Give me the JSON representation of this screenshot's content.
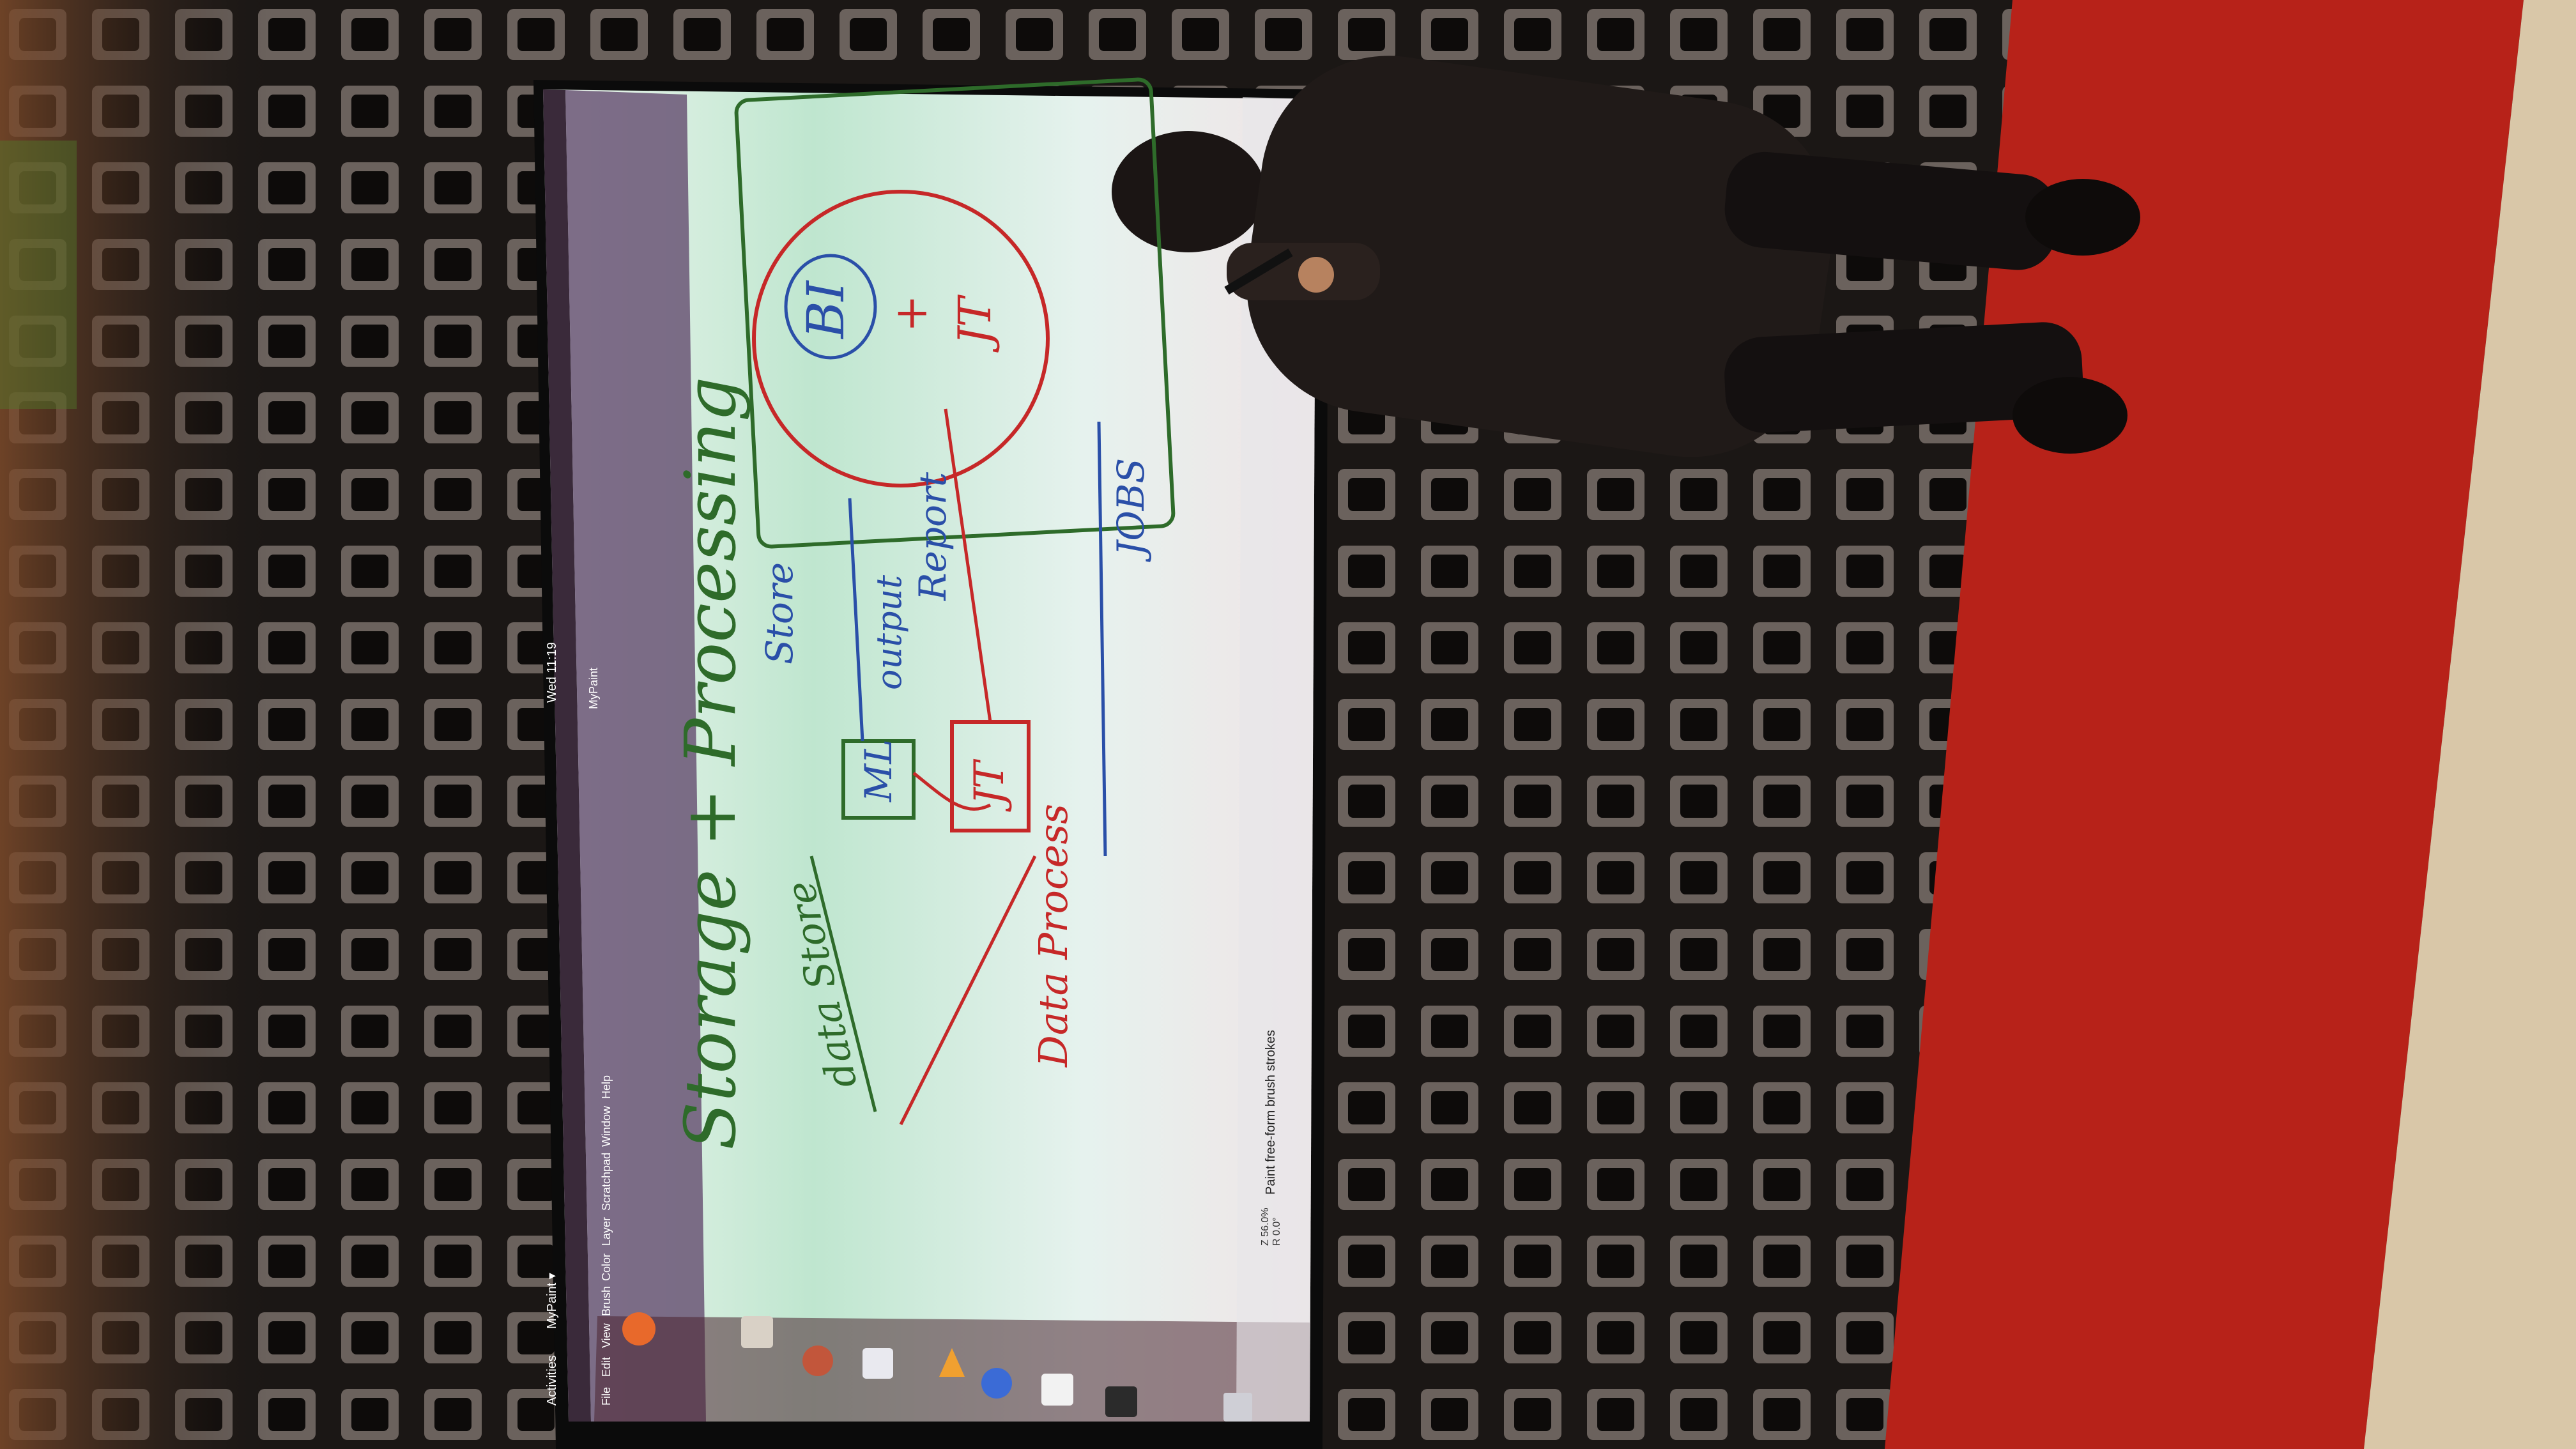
{
  "topbar": {
    "activities": "Activities",
    "app_menu": "MyPaint ▾",
    "clock": "Wed 11:19"
  },
  "window": {
    "title": "MyPaint",
    "menu": [
      "File",
      "Edit",
      "View",
      "Brush",
      "Color",
      "Layer",
      "Scratchpad",
      "Window",
      "Help"
    ]
  },
  "statusbar": {
    "message": "Paint free-form brush strokes",
    "zoom": "Z 56.0%",
    "rotation": "R 0.0°"
  },
  "canvas_text": {
    "title": "Storage + Processing",
    "data_store": "data Store",
    "data_process": "Data Process",
    "ml": "ML",
    "store": "Store",
    "output": "output",
    "report": "Report",
    "jt_box": "JT",
    "jobs": "JOBS",
    "circle_bi": "BI",
    "circle_plus": "+",
    "circle_jt": "JT"
  },
  "colors": {
    "wall": "#2e2723",
    "screen_bg": "#dff3ea",
    "stage": "#c0241b",
    "ink_red": "#c62828",
    "ink_green": "#2e6b2a",
    "ink_blue": "#2a4fa8",
    "toolbar": "#5d4a63"
  },
  "dock_icons": [
    "browser-icon",
    "files-icon",
    "camera-icon",
    "store-icon",
    "text-icon",
    "help-icon",
    "amazon-icon",
    "terminal-icon",
    "apps-grid-icon"
  ]
}
